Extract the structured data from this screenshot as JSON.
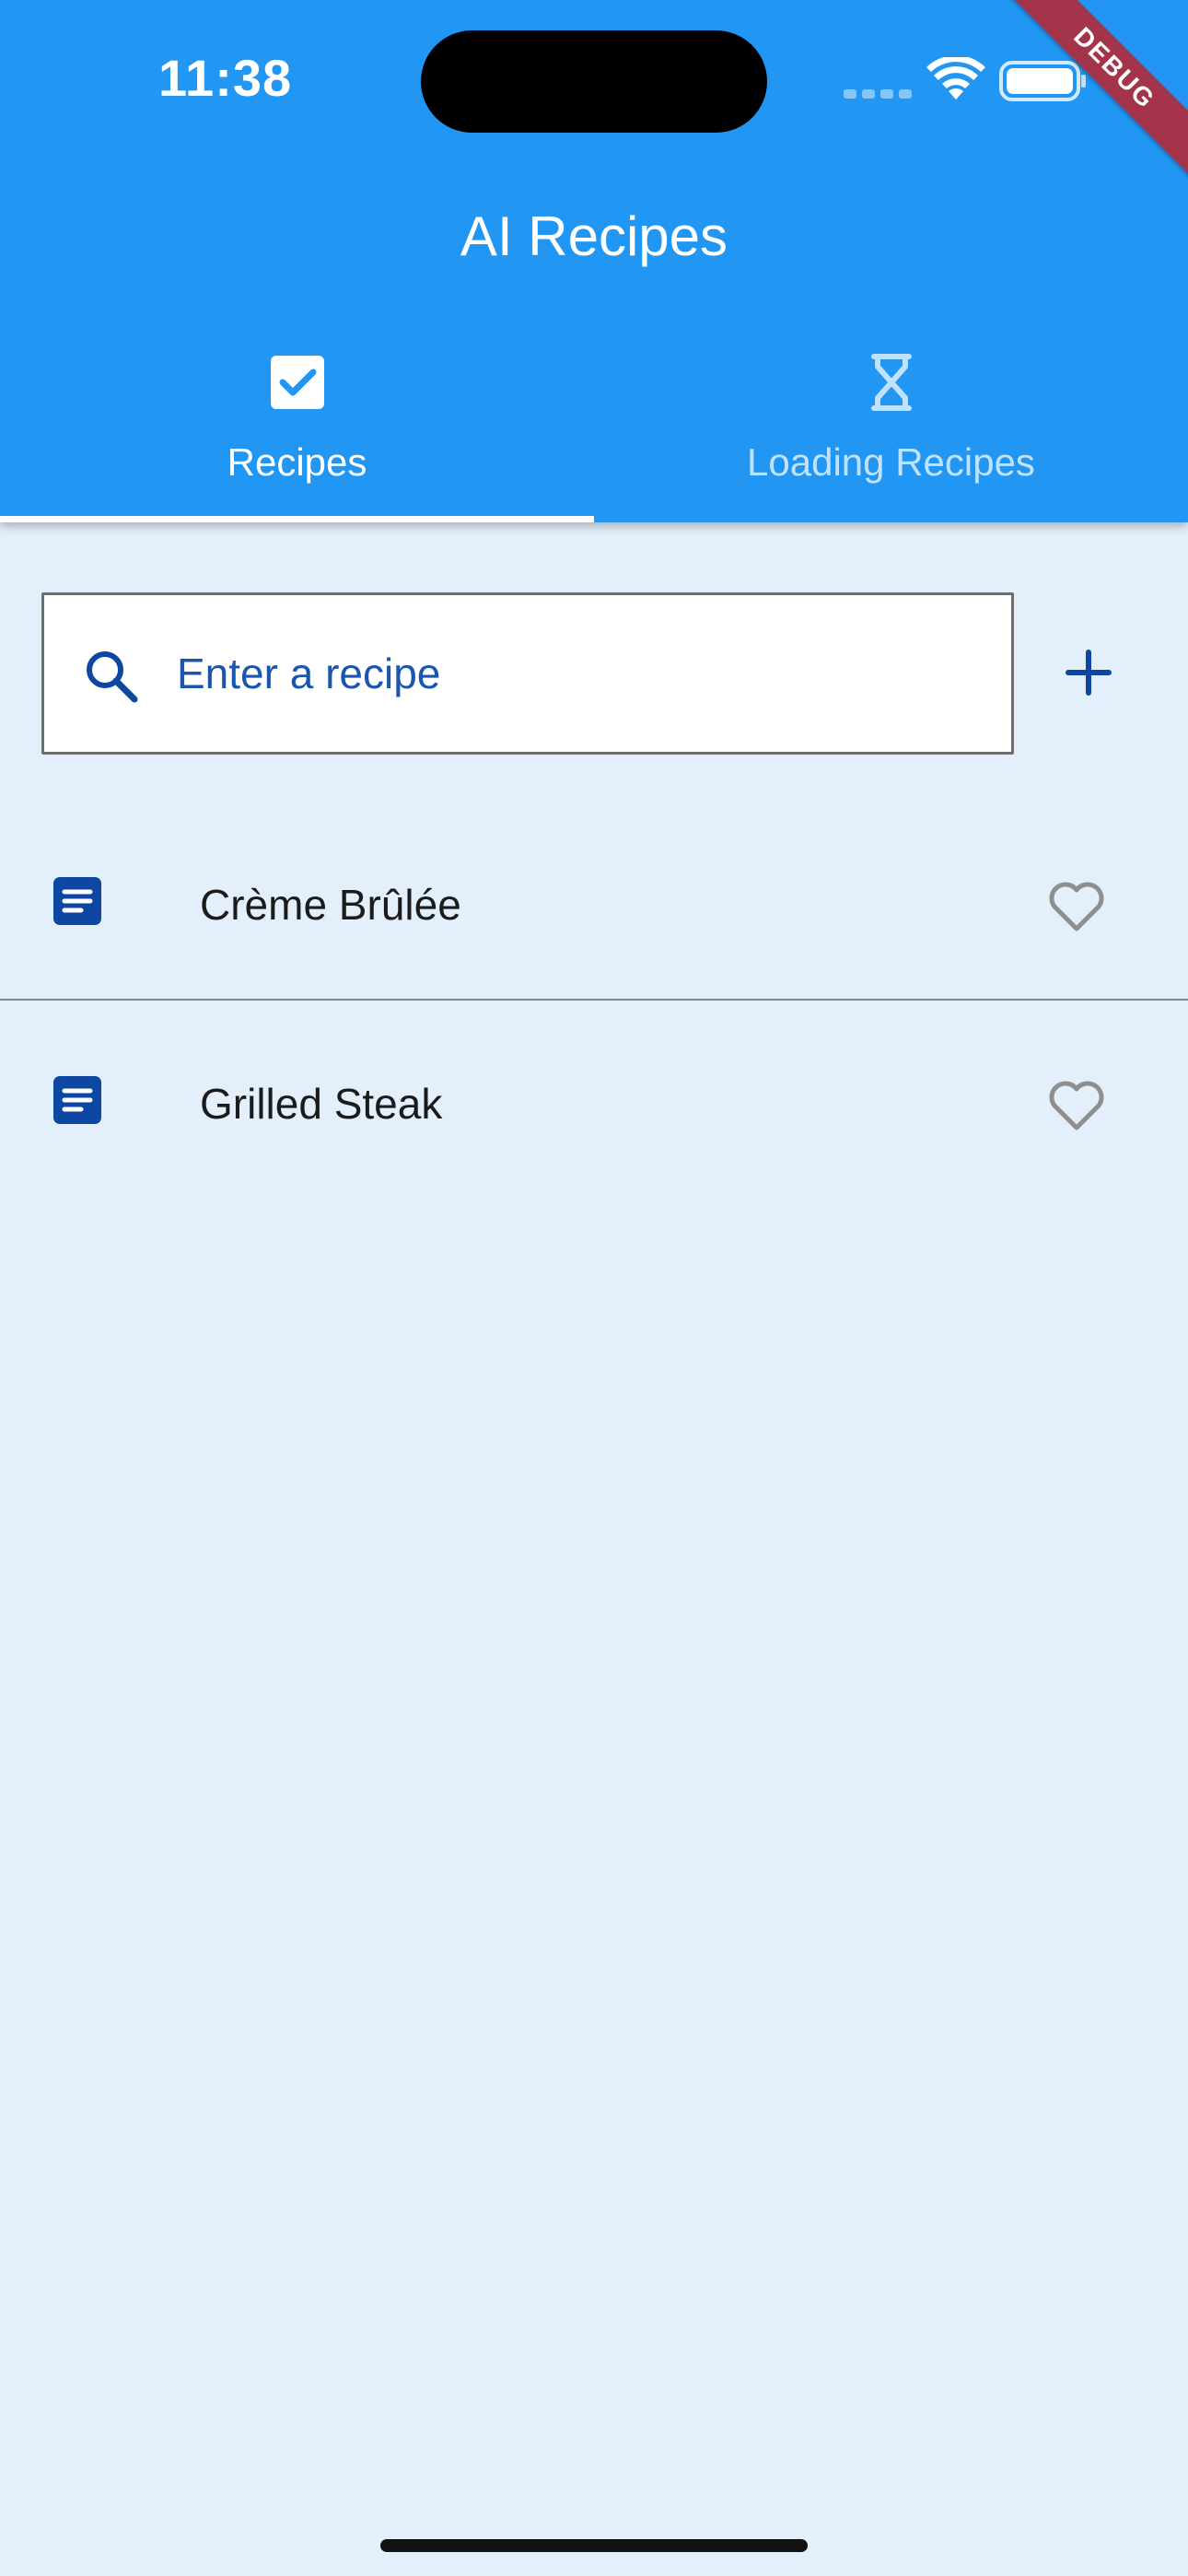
{
  "status_bar": {
    "time": "11:38"
  },
  "debug_banner": "DEBUG",
  "app_bar": {
    "title": "AI Recipes"
  },
  "tabs": [
    {
      "label": "Recipes",
      "icon": "checkbox-icon",
      "selected": true
    },
    {
      "label": "Loading Recipes",
      "icon": "hourglass-icon",
      "selected": false
    }
  ],
  "search": {
    "placeholder": "Enter a recipe",
    "value": ""
  },
  "recipes": [
    {
      "name": "Crème Brûlée",
      "icon": "document-icon",
      "favorite": false
    },
    {
      "name": "Grilled Steak",
      "icon": "document-icon",
      "favorite": false
    }
  ],
  "colors": {
    "app_bar": "#2196f3",
    "background": "#e3f0fc",
    "accent": "#0d47a1",
    "debug_ribbon": "#a3344a"
  }
}
